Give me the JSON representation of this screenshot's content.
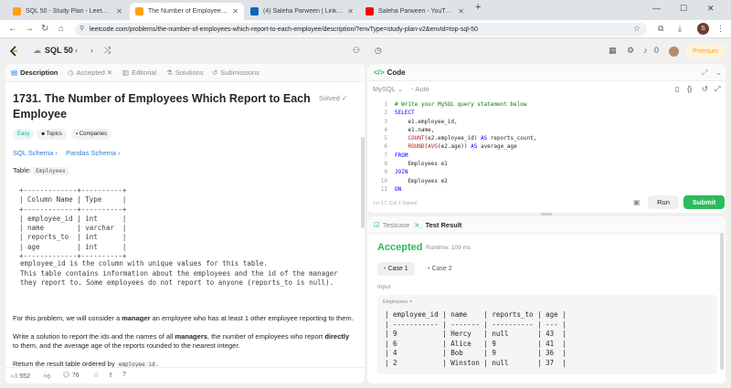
{
  "browser": {
    "tabs": [
      {
        "title": "SQL 50 - Study Plan - LeetCode",
        "favicon_color": "#ffa116"
      },
      {
        "title": "The Number of Employees Whi...",
        "favicon_color": "#ffa116"
      },
      {
        "title": "(4) Saleha Parween | LinkedIn",
        "favicon_color": "#0a66c2"
      },
      {
        "title": "Saleha Parween - YouTube",
        "favicon_color": "#ff0000"
      }
    ],
    "new_tab": "+",
    "window_controls": {
      "minimize": "—",
      "maximize": "☐",
      "close": "✕"
    },
    "url": "leetcode.com/problems/the-number-of-employees-which-report-to-each-employee/description/?envType=study-plan-v2&envId=top-sql-50",
    "profile_initial": "S"
  },
  "lc_nav": {
    "study_plan": "SQL 50",
    "premium": "Premium",
    "streak": "0"
  },
  "description": {
    "tabs": [
      "Description",
      "Accepted",
      "Editorial",
      "Solutions",
      "Submissions"
    ],
    "title": "1731. The Number of Employees Which Report to Each Employee",
    "status": "Solved",
    "tags": [
      "Easy",
      "Topics",
      "Companies"
    ],
    "schema_links": [
      "SQL Schema",
      "Pandas Schema"
    ],
    "table_label": "Table:",
    "table_name": "Employees",
    "schema_table": "+-------------+----------+\n| Column Name | Type     |\n+-------------+----------+\n| employee_id | int      |\n| name        | varchar  |\n| reports_to  | int      |\n| age         | int      |\n+-------------+----------+",
    "schema_note": "employee_id is the column with unique values for this table.\nThis table contains information about the employees and the id of the manager\nthey report to. Some employees do not report to anyone (reports_to is null).",
    "p1_a": "For this problem, we will consider a ",
    "p1_b": "manager",
    "p1_c": " an employee who has at least 1 other employee reporting to them.",
    "p2_a": "Write a solution to report the ids and the names of all ",
    "p2_b": "managers",
    "p2_c": ", the number of employees who report ",
    "p2_d": "directly",
    "p2_e": " to them, and the average age of the reports rounded to the nearest integer.",
    "p3_a": "Return the result table ordered by ",
    "p3_code": "employee_id",
    "p3_b": ".",
    "likes": "552",
    "comments": "76"
  },
  "code_panel": {
    "title": "Code",
    "language": "MySQL",
    "mode": "Auto",
    "line_numbers": [
      "1",
      "2",
      "3",
      "4",
      "5",
      "6",
      "7",
      "8",
      "9",
      "10",
      "11"
    ],
    "status": "Ln 17, Col 1    Saved",
    "run": "Run",
    "submit": "Submit"
  },
  "test_panel": {
    "tabs": [
      "Testcase",
      "Test Result"
    ],
    "result": "Accepted",
    "runtime": "Runtime: 109 ms",
    "cases": [
      "Case 1",
      "Case 2"
    ],
    "input_label": "Input",
    "input_var": "Employees =",
    "table": "| employee_id | name    | reports_to | age |\n| ----------- | ------- | ---------- | --- |\n| 9           | Hercy   | null       | 43  |\n| 6           | Alice   | 9          | 41  |\n| 4           | Bob     | 9          | 36  |\n| 2           | Winston | null       | 37  |"
  },
  "colors": {
    "accent_green": "#2cbb5d",
    "brand_orange": "#ffa116",
    "link_blue": "#2b7bd6"
  }
}
